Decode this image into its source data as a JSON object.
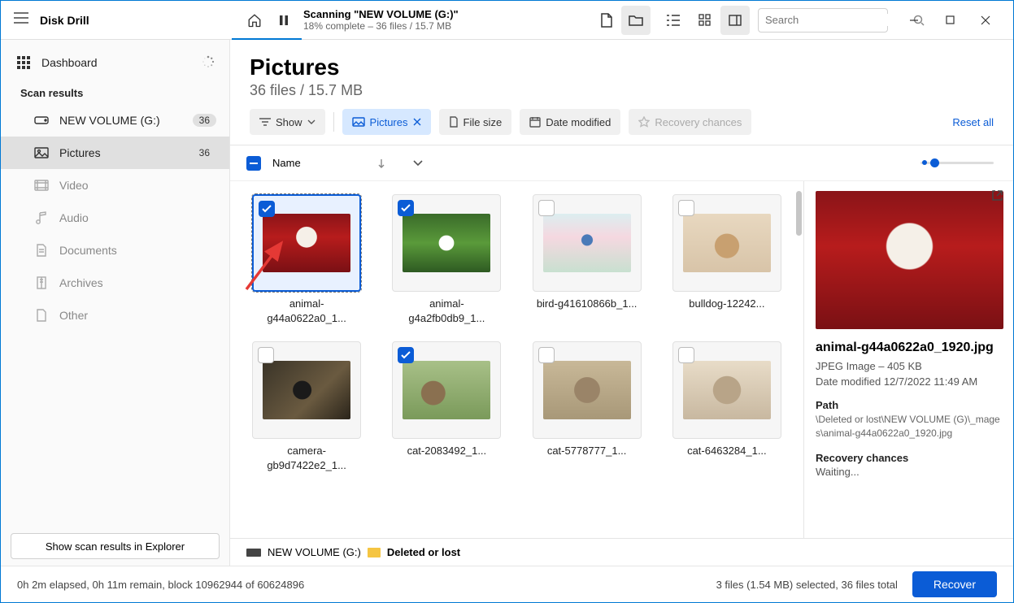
{
  "app": {
    "title": "Disk Drill"
  },
  "titlebar": {
    "scan_title": "Scanning \"NEW VOLUME (G:)\"",
    "scan_sub": "18% complete – 36 files / 15.7 MB",
    "search_placeholder": "Search"
  },
  "sidebar": {
    "dashboard": "Dashboard",
    "scan_results_heading": "Scan results",
    "items": [
      {
        "label": "NEW VOLUME (G:)",
        "count": "36"
      },
      {
        "label": "Pictures",
        "count": "36"
      },
      {
        "label": "Video"
      },
      {
        "label": "Audio"
      },
      {
        "label": "Documents"
      },
      {
        "label": "Archives"
      },
      {
        "label": "Other"
      }
    ],
    "explorer_btn": "Show scan results in Explorer"
  },
  "main": {
    "title": "Pictures",
    "subtitle": "36 files / 15.7 MB",
    "filters": {
      "show": "Show",
      "pictures": "Pictures",
      "file_size": "File size",
      "date_modified": "Date modified",
      "recovery_chances": "Recovery chances",
      "reset": "Reset all"
    },
    "columns": {
      "name": "Name"
    },
    "files": [
      {
        "name": "animal-g44a0622a0_1...",
        "name2": "",
        "checked": true,
        "selected": true,
        "swatch": "dog-red"
      },
      {
        "name": "animal-g4a2fb0db9_1...",
        "name2": "",
        "checked": true,
        "swatch": "dog-green"
      },
      {
        "name": "bird-g41610866b_1...",
        "name2": "",
        "swatch": "bird"
      },
      {
        "name": "bulldog-12242...",
        "swatch": "bulldog"
      },
      {
        "name": "camera-gb9d7422e2_1...",
        "swatch": "camera"
      },
      {
        "name": "cat-2083492_1...",
        "checked": true,
        "swatch": "cat1"
      },
      {
        "name": "cat-5778777_1...",
        "swatch": "cat2"
      },
      {
        "name": "cat-6463284_1...",
        "swatch": "cat3"
      }
    ],
    "breadcrumb": {
      "drive": "NEW VOLUME (G:)",
      "folder": "Deleted or lost"
    }
  },
  "detail": {
    "filename": "animal-g44a0622a0_1920.jpg",
    "type_size": "JPEG Image – 405 KB",
    "date": "Date modified 12/7/2022 11:49 AM",
    "path_label": "Path",
    "path": "\\Deleted or lost\\NEW VOLUME (G)\\_mages\\animal-g44a0622a0_1920.jpg",
    "rc_label": "Recovery chances",
    "rc_value": "Waiting..."
  },
  "status": {
    "elapsed": "0h 2m elapsed, 0h 11m remain, block 10962944 of 60624896",
    "selection": "3 files (1.54 MB) selected, 36 files total",
    "recover": "Recover"
  }
}
